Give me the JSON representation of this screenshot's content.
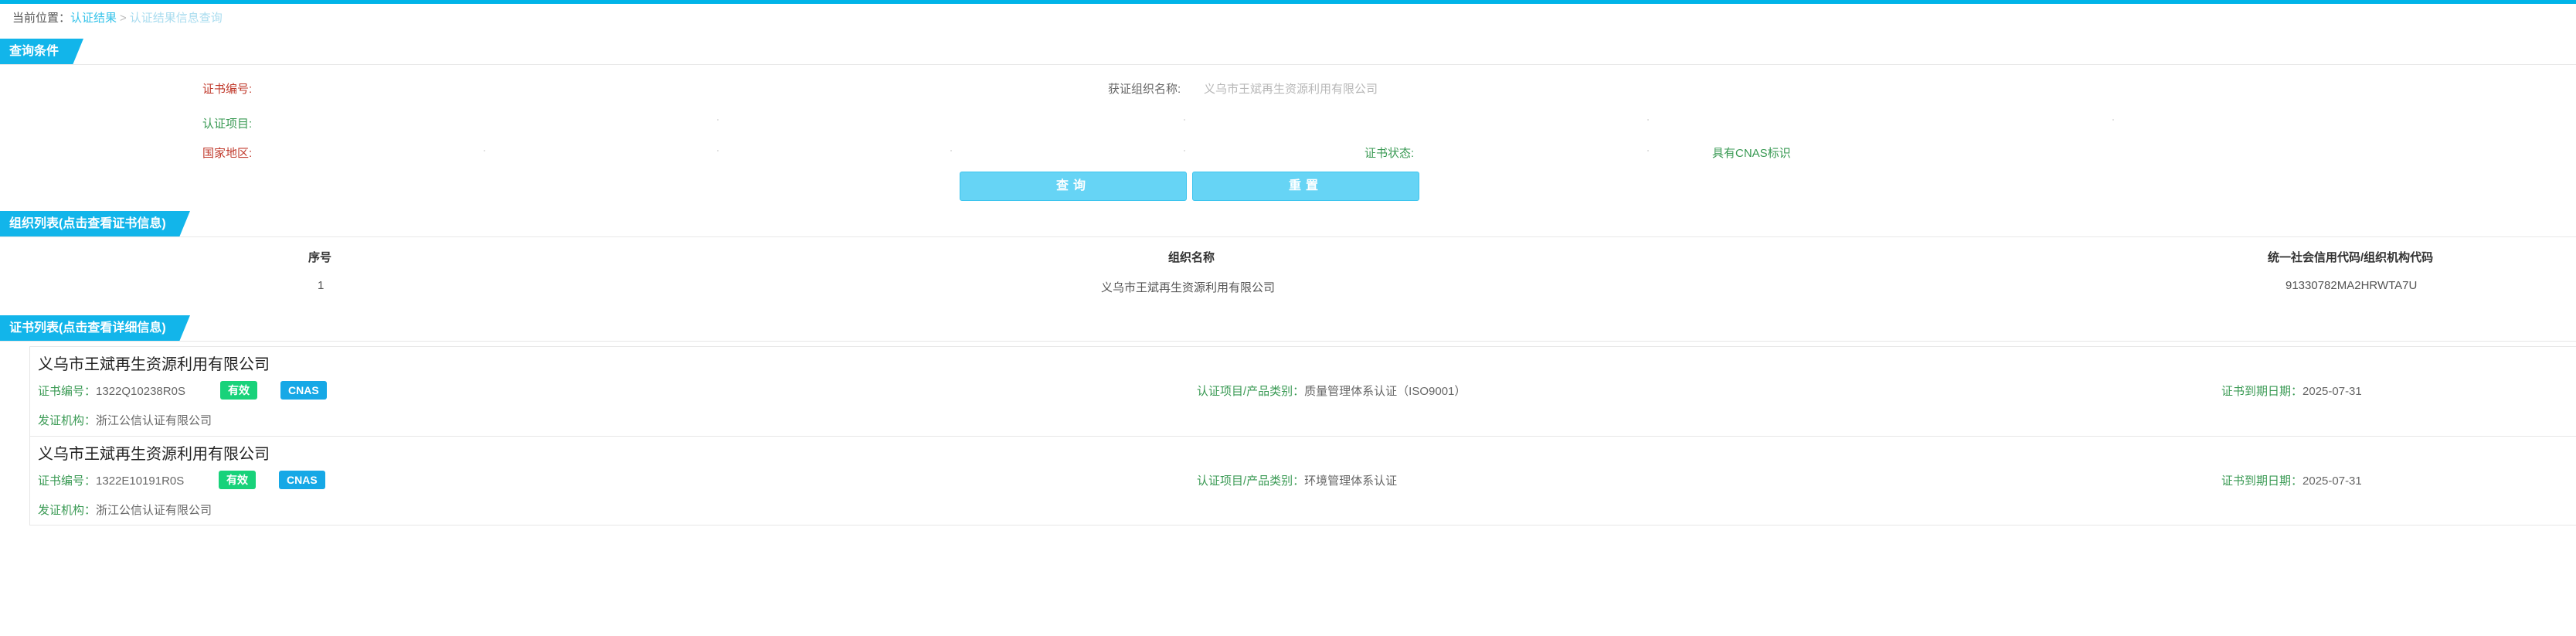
{
  "breadcrumb": {
    "label": "当前位置：",
    "link1": "认证结果",
    "separator": ">",
    "link2": "认证结果信息查询"
  },
  "sections": {
    "query": "查询条件",
    "org_list": "组织列表(点击查看证书信息)",
    "cert_list": "证书列表(点击查看详细信息)"
  },
  "query": {
    "cert_no_label": "证书编号:",
    "cert_no_value": "",
    "org_name_label": "获证组织名称:",
    "org_name_value": "义乌市王斌再生资源利用有限公司",
    "project_label": "认证项目:",
    "project_value": "",
    "region_label": "国家地区:",
    "region_value": "",
    "status_label": "证书状态:",
    "status_value": "",
    "cnas_label": "具有CNAS标识",
    "search_button": "查询",
    "reset_button": "重置"
  },
  "org_table": {
    "headers": [
      "序号",
      "组织名称",
      "统一社会信用代码/组织机构代码"
    ],
    "rows": [
      [
        "1",
        "义乌市王斌再生资源利用有限公司",
        "91330782MA2HRWTA7U"
      ]
    ]
  },
  "certificates": [
    {
      "title": "义乌市王斌再生资源利用有限公司",
      "cert_no_key": "证书编号：",
      "cert_no": "1322Q10238R0S",
      "status_badge": "有效",
      "cnas_badge": "CNAS",
      "project_key": "认证项目/产品类别：",
      "project": "质量管理体系认证（ISO9001）",
      "expiry_key": "证书到期日期：",
      "expiry": "2025-07-31",
      "issuer_key": "发证机构：",
      "issuer": "浙江公信认证有限公司"
    },
    {
      "title": "义乌市王斌再生资源利用有限公司",
      "cert_no_key": "证书编号：",
      "cert_no": "1322E10191R0S",
      "status_badge": "有效",
      "cnas_badge": "CNAS",
      "project_key": "认证项目/产品类别：",
      "project": "环境管理体系认证",
      "expiry_key": "证书到期日期：",
      "expiry": "2025-07-31",
      "issuer_key": "发证机构：",
      "issuer": "浙江公信认证有限公司"
    }
  ],
  "colors": {
    "accent": "#12b5ea",
    "button": "#66d4f5",
    "badge_valid": "#18d27a",
    "badge_cnas": "#16a8e6",
    "label_green": "#3a9a54"
  }
}
